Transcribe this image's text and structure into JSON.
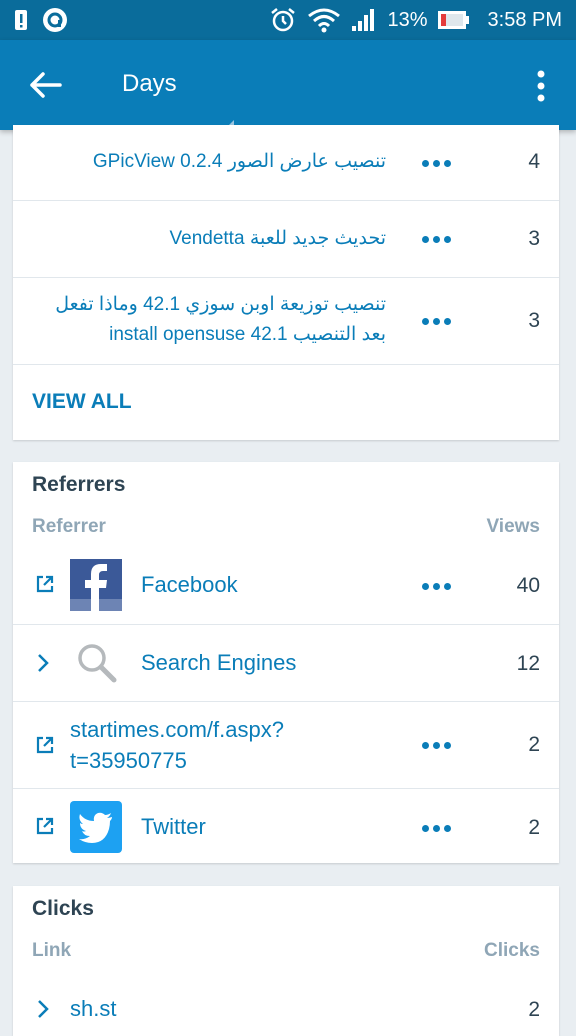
{
  "statusbar": {
    "battery_pct": "13%",
    "time": "3:58 PM"
  },
  "appbar": {
    "title": "Days"
  },
  "posts": {
    "rows": [
      {
        "title": "تنصيب عارض الصور GPicView 0.2.4",
        "count": "4"
      },
      {
        "title": "تحديث جديد للعبة Vendetta",
        "count": "3"
      },
      {
        "title_line1": "تنصيب توزيعة اوبن سوزي 42.1 وماذا تفعل",
        "title_line2": "بعد التنصيب install opensuse 42.1",
        "count": "3"
      }
    ],
    "view_all": "VIEW ALL"
  },
  "referrers": {
    "heading": "Referrers",
    "col_left": "Referrer",
    "col_right": "Views",
    "rows": [
      {
        "label": "Facebook",
        "count": "40",
        "icon": "facebook-icon"
      },
      {
        "label": "Search Engines",
        "count": "12",
        "icon": "search-icon"
      },
      {
        "label_line1": "startimes.com/f.aspx?",
        "label_line2": "t=35950775",
        "count": "2",
        "icon": "external-link-icon"
      },
      {
        "label": "Twitter",
        "count": "2",
        "icon": "twitter-icon"
      }
    ]
  },
  "clicks": {
    "heading": "Clicks",
    "col_left": "Link",
    "col_right": "Clicks",
    "rows": [
      {
        "label": "sh.st",
        "count": "2"
      }
    ]
  },
  "colors": {
    "accent": "#0a7db8",
    "statusbar": "#0a6c9b",
    "text": "#2e4453",
    "muted": "#8fa6b6",
    "facebook": "#3b5998",
    "twitter": "#1da1f2"
  }
}
